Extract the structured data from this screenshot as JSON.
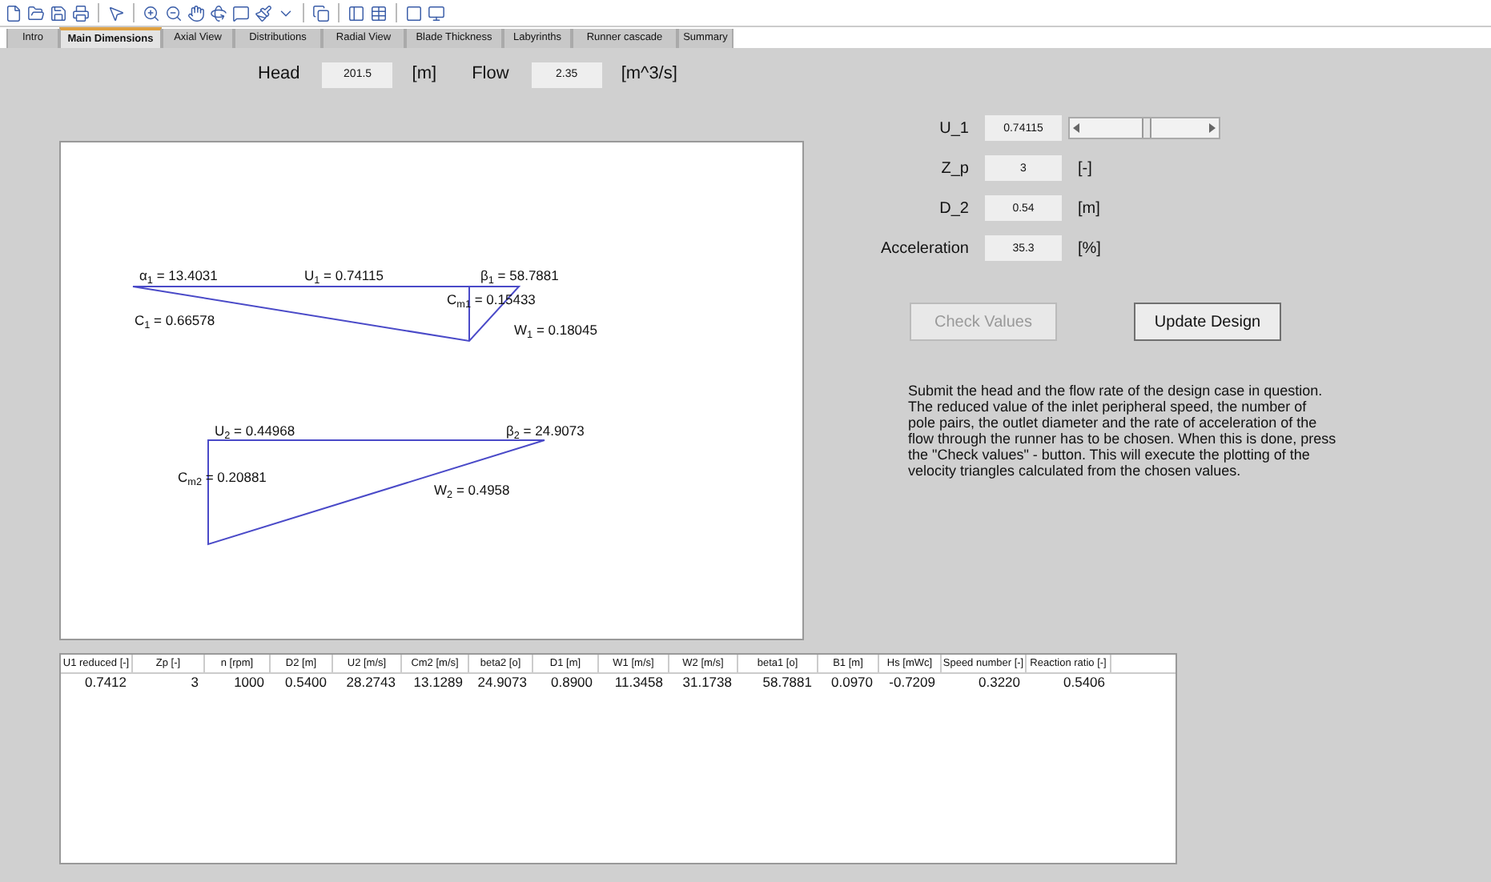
{
  "tabs": [
    {
      "label": "Intro",
      "selected": false
    },
    {
      "label": "Main Dimensions",
      "selected": true
    },
    {
      "label": "Axial View",
      "selected": false
    },
    {
      "label": "Distributions",
      "selected": false
    },
    {
      "label": "Radial View",
      "selected": false
    },
    {
      "label": "Blade Thickness",
      "selected": false
    },
    {
      "label": "Labyrinths",
      "selected": false
    },
    {
      "label": "Runner cascade",
      "selected": false
    },
    {
      "label": "Summary",
      "selected": false
    }
  ],
  "inputs": [
    {
      "label": "Head",
      "value": "201.5",
      "unit": "[m]"
    },
    {
      "label": "Flow",
      "value": "2.35",
      "unit": "[m^3/s]"
    }
  ],
  "plot_labels": [
    "α$_{1}$ = 13.4031",
    "U$_{1}$ = 0.74115",
    "β$_{1}$ = 58.7881",
    "C$_{m1}$ = 0.15433",
    "C$_{1}$ = 0.66578",
    "W$_{1}$ = 0.18045",
    "U$_{2}$ = 0.44968",
    "β$_{2}$ = 24.9073",
    "C$_{m2}$ = 0.20881",
    "W$_{2}$ = 0.4958"
  ],
  "params": [
    {
      "kind": "slider",
      "label": "U_1",
      "value": "0.74115",
      "level": 0.5
    },
    {
      "kind": "field",
      "label": "Z_p",
      "value": "3",
      "unit": "[-]"
    },
    {
      "kind": "field",
      "label": "D_2",
      "value": "0.54",
      "unit": "[m]"
    },
    {
      "kind": "field",
      "label": "Acceleration",
      "value": "35.3",
      "unit": "[%]"
    }
  ],
  "buttons": [
    {
      "label": "Check Values",
      "disabled": true
    },
    {
      "label": "Update Design",
      "disabled": false
    }
  ],
  "description": "Submit the head and the flow rate of the design case in question. The reduced value of the inlet peripheral speed, the number of pole pairs, the outlet diameter and the rate of acceleration of the flow through the runner has to be chosen. When this is done, press the \"Check values\" - button. This will execute the plotting of the velocity triangles calculated from the chosen values.",
  "table": {
    "columns": [
      "U1 reduced [-]",
      "Zp [-]",
      "n [rpm]",
      "D2 [m]",
      "U2 [m/s]",
      "Cm2 [m/s]",
      "beta2 [o]",
      "D1 [m]",
      "W1 [m/s]",
      "W2 [m/s]",
      "beta1 [o]",
      "B1 [m]",
      "Hs [mWc]",
      "Speed number [-]",
      "Reaction ratio [-]"
    ],
    "rows": [
      [
        "0.7412",
        "3",
        "1000",
        "0.5400",
        "28.2743",
        "13.1289",
        "24.9073",
        "0.8900",
        "11.3458",
        "31.1738",
        "58.7881",
        "0.0970",
        "-0.7209",
        "0.3220",
        "0.5406"
      ]
    ]
  }
}
